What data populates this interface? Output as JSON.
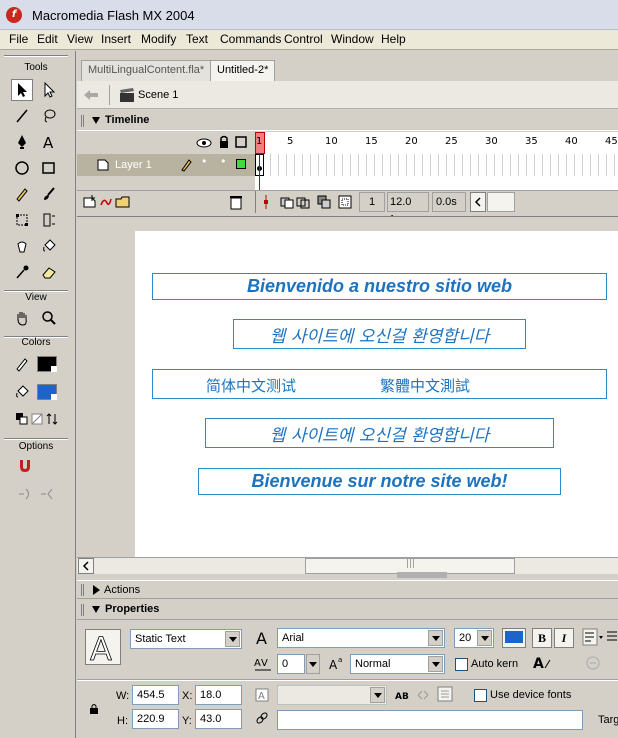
{
  "window": {
    "title": "Macromedia Flash MX 2004"
  },
  "menu": [
    "File",
    "Edit",
    "View",
    "Insert",
    "Modify",
    "Text",
    "Commands",
    "Control",
    "Window",
    "Help"
  ],
  "tools_panel": {
    "tools_label": "Tools",
    "view_label": "View",
    "colors_label": "Colors",
    "options_label": "Options",
    "stroke_color": "#000000",
    "fill_color": "#1e64c8"
  },
  "doc_tabs": [
    {
      "label": "MultiLingualContent.fla*",
      "active": false
    },
    {
      "label": "Untitled-2*",
      "active": true
    }
  ],
  "edit_bar": {
    "scene": "Scene 1"
  },
  "timeline": {
    "title": "Timeline",
    "frame_numbers": [
      "1",
      "5",
      "10",
      "15",
      "20",
      "25",
      "30",
      "35",
      "40",
      "45"
    ],
    "layer_name": "Layer 1",
    "current_frame": "1",
    "fps": "12.0 fps",
    "time": "0.0s"
  },
  "stage": {
    "texts": [
      "Bienvenido a nuestro sitio web",
      "웹 사이트에 오신걸 환영합니다",
      "简体中文测试",
      "繁體中文測試",
      "웹 사이트에 오신걸 환영합니다",
      "Bienvenue sur notre site web!"
    ]
  },
  "panels": {
    "actions_title": "Actions",
    "properties_title": "Properties"
  },
  "properties": {
    "text_type": "Static Text",
    "font": "Arial",
    "font_size": "20",
    "text_color": "#1e64c8",
    "bold_label": "B",
    "italic_label": "I",
    "letter_spacing": "0",
    "char_position": "Normal",
    "auto_kern_label": "Auto kern",
    "use_device_fonts_label": "Use device fonts",
    "w_label": "W:",
    "w_value": "454.5",
    "h_label": "H:",
    "h_value": "220.9",
    "x_label": "X:",
    "x_value": "18.0",
    "y_label": "Y:",
    "y_value": "43.0",
    "target_label": "Targ"
  }
}
